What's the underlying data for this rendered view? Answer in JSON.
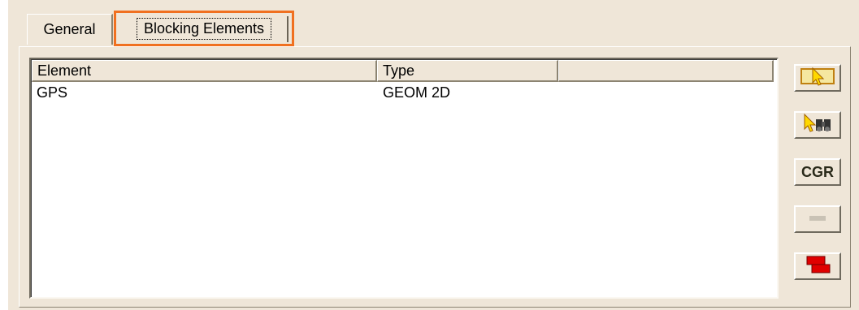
{
  "tabs": [
    {
      "label": "General",
      "selected": false
    },
    {
      "label": "Blocking Elements",
      "selected": true
    }
  ],
  "list": {
    "columns": [
      "Element",
      "Type",
      ""
    ],
    "rows": [
      {
        "element": "GPS",
        "type": "GEOM 2D"
      }
    ]
  },
  "side_buttons": [
    {
      "icon": "select-in-frame-icon"
    },
    {
      "icon": "select-with-binoculars-icon"
    },
    {
      "label": "CGR"
    },
    {
      "icon": "remove-icon",
      "enabled": false
    },
    {
      "icon": "red-layers-icon"
    }
  ],
  "colors": {
    "highlight": "#f07020",
    "dialog_bg": "#efe6d8"
  }
}
